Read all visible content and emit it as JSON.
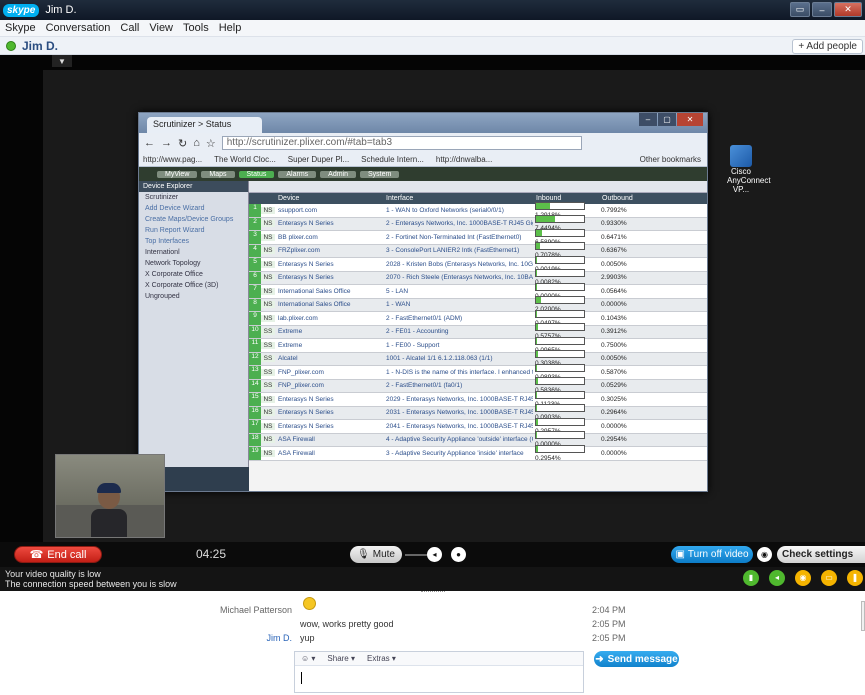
{
  "window": {
    "title": "Jim D.",
    "logo": "skype"
  },
  "menu": [
    "Skype",
    "Conversation",
    "Call",
    "View",
    "Tools",
    "Help"
  ],
  "contact": {
    "name": "Jim D.",
    "add_people": "+ Add people"
  },
  "remote": {
    "browser": {
      "tab_title": "Scrutinizer > Status",
      "url": "http://scrutinizer.plixer.com/#tab=tab3",
      "bookmarks": [
        "http://www.pag...",
        "The World Cloc...",
        "Super Duper Pl...",
        "Schedule Intern...",
        "http://dnwalba...",
        "Other bookmarks"
      ],
      "app_tabs": [
        "MyView",
        "Maps",
        "Status",
        "Alarms",
        "Admin",
        "System"
      ],
      "sidebar": {
        "header": "Device Explorer",
        "items": [
          "Scrutinizer",
          "Add Device Wizard",
          "Create Maps/Device Groups",
          "Run Report Wizard",
          "Top Interfaces",
          "Internationl",
          "Network Topology",
          "X Corporate Office",
          "X Corporate Office (3D)",
          "Ungrouped"
        ]
      },
      "columns": [
        "",
        "",
        "Device",
        "Interface",
        "Inbound",
        "Outbound"
      ],
      "rows": [
        {
          "n": "1",
          "ns": "NS",
          "device": "ssupport.com",
          "iface": "1 - WAN to Oxford Networks (serial0/0/1)",
          "in": "1.2918%",
          "out": "0.7992%",
          "in_pct": 0.3
        },
        {
          "n": "2",
          "ns": "NS",
          "device": "Enterasys N Series",
          "iface": "2 - Enterasys Networks, Inc. 1000BASE-T RJ45 Gigabit Ethernet Frontpanel Port (ge.1.47)",
          "in": "7.4494%",
          "out": "0.9330%",
          "in_pct": 0.4
        },
        {
          "n": "3",
          "ns": "NS",
          "device": "BB plixer.com",
          "iface": "2 - Fortinet Non-Terminated Int (FastEthernet0)",
          "in": "6.5890%",
          "out": "0.6471%",
          "in_pct": 0.12
        },
        {
          "n": "4",
          "ns": "NS",
          "device": "FRZplixer.com",
          "iface": "3 - ConsolePort LANIER2 Intk (FastEthernet1)",
          "in": "0.7078%",
          "out": "0.6367%",
          "in_pct": 0.08
        },
        {
          "n": "5",
          "ns": "NS",
          "device": "Enterasys N Series",
          "iface": "2028 - Kristen Bobs (Enterasys Networks, Inc. 10GBASE-T RJ45 Gigabit Ethernet Frontpanel Port)",
          "in": "0.0019%",
          "out": "0.0050%",
          "in_pct": 0.02
        },
        {
          "n": "6",
          "ns": "NS",
          "device": "Enterasys N Series",
          "iface": "2070 - Rich Steele (Enterasys Networks, Inc. 10BASE-T RJ45 Gigabit Ethernet Frontpanel Port)",
          "in": "0.0082%",
          "out": "2.9903%",
          "in_pct": 0.02
        },
        {
          "n": "7",
          "ns": "NS",
          "device": "International Sales Office",
          "iface": "5 - LAN",
          "in": "0.0000%",
          "out": "0.0564%",
          "in_pct": 0.01
        },
        {
          "n": "8",
          "ns": "NS",
          "device": "International Sales Office",
          "iface": "1 - WAN",
          "in": "2.0200%",
          "out": "0.0000%",
          "in_pct": 0.1
        },
        {
          "n": "9",
          "ns": "NS",
          "device": "lab.plixer.com",
          "iface": "2 - FastEthernet0/1 (ADM)",
          "in": "0.0497%",
          "out": "0.1043%",
          "in_pct": 0.02
        },
        {
          "n": "10",
          "ns": "SS",
          "device": "Extreme",
          "iface": "2 - FE01 - Accounting",
          "in": "0.5757%",
          "out": "0.3912%",
          "in_pct": 0.05
        },
        {
          "n": "11",
          "ns": "SS",
          "device": "Extreme",
          "iface": "1 - FE00 - Support",
          "in": "0.0965%",
          "out": "0.7500%",
          "in_pct": 0.03
        },
        {
          "n": "12",
          "ns": "SS",
          "device": "Alcatel",
          "iface": "1001 - Alcatel 1/1 6.1.2.118.063 (1/1)",
          "in": "0.3038%",
          "out": "0.0050%",
          "in_pct": 0.04
        },
        {
          "n": "13",
          "ns": "SS",
          "device": "FNP_plixer.com",
          "iface": "1 - N-DIS is the name of this interface. I enhanced this because cool (FastEthernet0/0)",
          "in": "0.0893%",
          "out": "0.5870%",
          "in_pct": 0.02
        },
        {
          "n": "14",
          "ns": "SS",
          "device": "FNP_plixer.com",
          "iface": "2 - FastEthernet0/1 (fa0/1)",
          "in": "0.5836%",
          "out": "0.0529%",
          "in_pct": 0.05
        },
        {
          "n": "15",
          "ns": "NS",
          "device": "Enterasys N Series",
          "iface": "2029 - Enterasys Networks, Inc. 1000BASE-T RJ45 Gigabit Ethernet Frontpanel Port (ge.1.25)",
          "in": "0.1123%",
          "out": "0.3025%",
          "in_pct": 0.03
        },
        {
          "n": "16",
          "ns": "NS",
          "device": "Enterasys N Series",
          "iface": "2031 - Enterasys Networks, Inc. 1000BASE-T RJ45 Gigabit Ethernet Frontpanel Port (ge.1.23)",
          "in": "0.0903%",
          "out": "0.2964%",
          "in_pct": 0.02
        },
        {
          "n": "17",
          "ns": "NS",
          "device": "Enterasys N Series",
          "iface": "2041 - Enterasys Networks, Inc. 1000BASE-T RJ45 Gigabit Ethernet Frontpanel Port (ge.1.34)",
          "in": "0.2957%",
          "out": "0.0000%",
          "in_pct": 0.04
        },
        {
          "n": "18",
          "ns": "NS",
          "device": "ASA Firewall",
          "iface": "4 - Adaptive Security Appliance 'outside' interface (Outside)",
          "in": "0.0000%",
          "out": "0.2954%",
          "in_pct": 0.01
        },
        {
          "n": "19",
          "ns": "NS",
          "device": "ASA Firewall",
          "iface": "3 - Adaptive Security Appliance 'inside' interface",
          "in": "0.2954%",
          "out": "0.0000%",
          "in_pct": 0.04
        }
      ]
    },
    "desktop_icon": "Cisco AnyConnect VP..."
  },
  "controls": {
    "end_call": "End call",
    "timer": "04:25",
    "mute": "Mute",
    "turn_off_video": "Turn off video",
    "check_settings": "Check settings"
  },
  "notice": {
    "line1": "Your video quality is low",
    "line2": "The connection speed between you is slow"
  },
  "chat": {
    "messages": [
      {
        "sender": "Michael Patterson",
        "text": "",
        "time": "2:04 PM",
        "emoticon": "smiley"
      },
      {
        "sender": "",
        "text": "wow, works pretty good",
        "time": "2:05 PM"
      },
      {
        "sender": "Jim D.",
        "text": "yup",
        "time": "2:05 PM"
      }
    ],
    "toolbar": {
      "emoticon": "☺ ▾",
      "share": "Share ▾",
      "extras": "Extras ▾"
    },
    "send": "Send message"
  },
  "colors": {
    "accent": "#00aff0",
    "end_call": "#d9342a",
    "send": "#1c93df"
  }
}
